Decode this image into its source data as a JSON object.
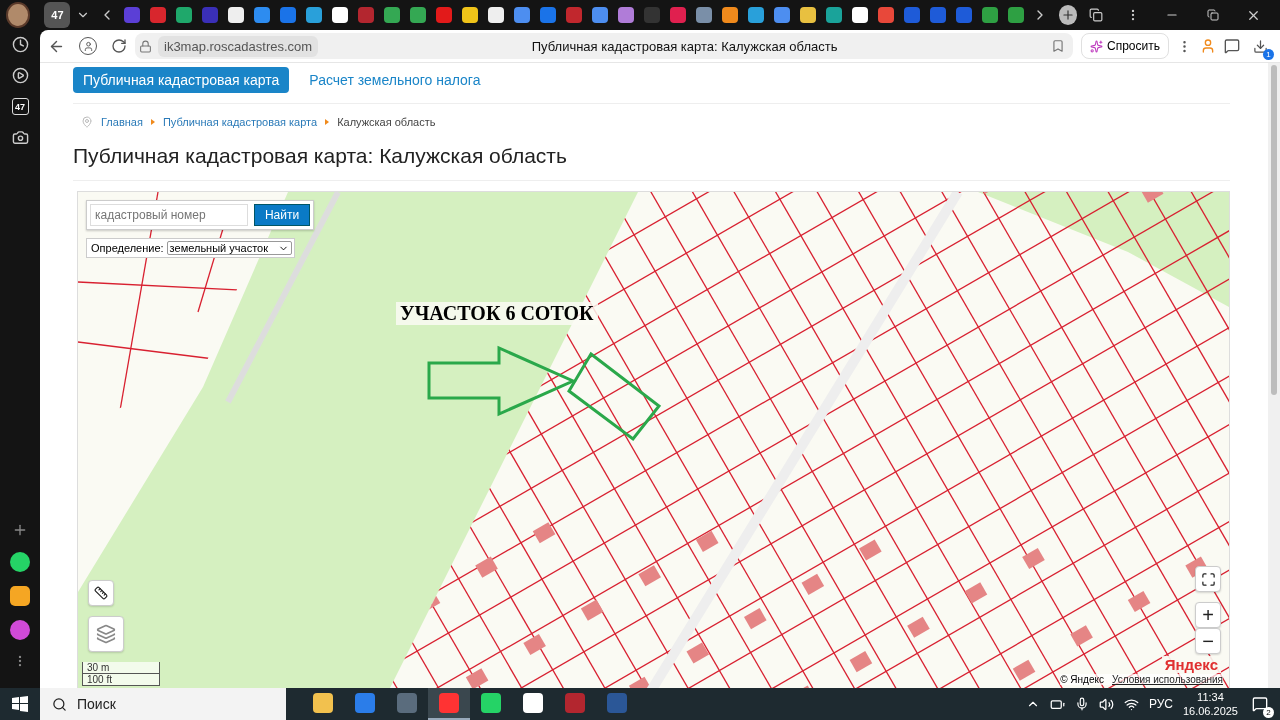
{
  "browser": {
    "tab_count": "47",
    "url": "ik3map.roscadastres.com",
    "page_title": "Публичная кадастровая карта: Калужская область",
    "ask_button": "Спросить",
    "downloads_badge": "1"
  },
  "favicons": [
    {
      "color": "#5b3fd6"
    },
    {
      "color": "#d8262d"
    },
    {
      "color": "#1fa86b"
    },
    {
      "color": "#3a2fb8"
    },
    {
      "color": "#eeeeee"
    },
    {
      "color": "#2d8cf0"
    },
    {
      "color": "#1a73e8"
    },
    {
      "color": "#29a0da"
    },
    {
      "color": "#ffffff"
    },
    {
      "color": "#b3262f"
    },
    {
      "color": "#34a853"
    },
    {
      "color": "#34a853"
    },
    {
      "color": "#e21a1a"
    },
    {
      "color": "#f0c419"
    },
    {
      "color": "#eeeeee"
    },
    {
      "color": "#4d8ef0"
    },
    {
      "color": "#1a73e8"
    },
    {
      "color": "#c1272d"
    },
    {
      "color": "#4d8ef0"
    },
    {
      "color": "#b07cd8"
    },
    {
      "color": "#333333"
    },
    {
      "color": "#e0204f"
    },
    {
      "color": "#7a8fa8"
    },
    {
      "color": "#f08a1c"
    },
    {
      "color": "#29a0da"
    },
    {
      "color": "#4d8ef0"
    },
    {
      "color": "#e8c040"
    },
    {
      "color": "#1aa39a"
    },
    {
      "color": "#ffffff"
    },
    {
      "color": "#e8483a"
    },
    {
      "color": "#1e5bd8"
    },
    {
      "color": "#1e5bd8"
    },
    {
      "color": "#1e5bd8"
    },
    {
      "color": "#2ea043"
    },
    {
      "color": "#2ea043"
    }
  ],
  "sidebar": {
    "badge": "47"
  },
  "site": {
    "nav": [
      {
        "label": "Публичная кадастровая карта",
        "selected": true
      },
      {
        "label": "Расчет земельного налога",
        "selected": false
      }
    ],
    "breadcrumbs": [
      "Главная",
      "Публичная кадастровая карта",
      "Калужская область"
    ],
    "heading": "Публичная кадастровая карта: Калужская область"
  },
  "map": {
    "search": {
      "placeholder": "кадастровый номер",
      "button": "Найти"
    },
    "definition": {
      "label": "Определение:",
      "value": "земельный участок"
    },
    "annotation": "УЧАСТОК 6 СОТОК",
    "scale": [
      "30 m",
      "100 ft"
    ],
    "zoom_in": "+",
    "zoom_out": "−",
    "copyright": "© Яндекс",
    "terms": "Условия использования",
    "logo": "Яндекс"
  },
  "taskbar": {
    "search_placeholder": "Поиск",
    "apps": [
      {
        "color": "#f2c14e",
        "selected": false
      },
      {
        "color": "#2b7de9",
        "selected": false
      },
      {
        "color": "#5a6c7d",
        "selected": false
      },
      {
        "color": "#ff3333",
        "selected": true
      },
      {
        "color": "#25d366",
        "selected": false
      },
      {
        "color": "#ffffff",
        "selected": false
      },
      {
        "color": "#b3262f",
        "selected": false
      },
      {
        "color": "#2b5797",
        "selected": false
      }
    ],
    "language": "РУС",
    "time": "11:34",
    "date": "16.06.2025",
    "notifications": "2"
  }
}
